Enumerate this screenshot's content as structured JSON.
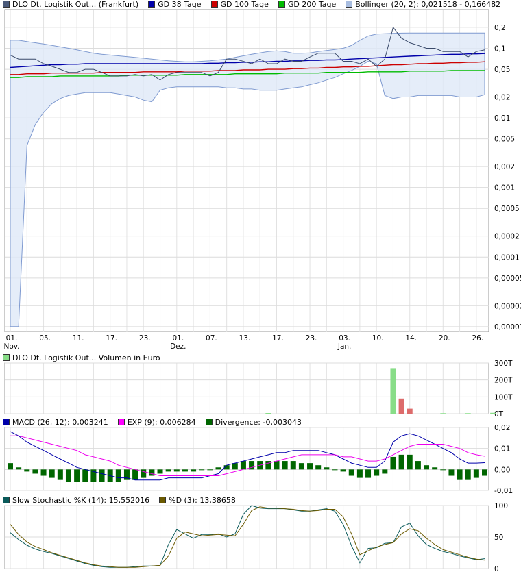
{
  "legends": {
    "price": [
      {
        "label": "DLO Dt. Logistik Out... (Frankfurt)",
        "color": "#4a5a7a"
      },
      {
        "label": "GD 38 Tage",
        "color": "#0000aa"
      },
      {
        "label": "GD 100 Tage",
        "color": "#cc0000"
      },
      {
        "label": "GD 200 Tage",
        "color": "#00bb00"
      },
      {
        "label": "Bollinger (20, 2): 0,021518 - 0,166482",
        "color": "#a8bde0"
      }
    ],
    "volume": [
      {
        "label": "DLO Dt. Logistik Out... Volumen in Euro",
        "color": "#88dd88"
      }
    ],
    "macd": [
      {
        "label": "MACD (26, 12): 0,003241",
        "color": "#0000aa"
      },
      {
        "label": "EXP (9): 0,006284",
        "color": "#ff00ff"
      },
      {
        "label": "Divergence: -0,003043",
        "color": "#006600"
      }
    ],
    "stoch": [
      {
        "label": "Slow Stochastic %K (14): 15,552016",
        "color": "#0a5a5a"
      },
      {
        "label": "%D (3): 13,38658",
        "color": "#6b5a00"
      }
    ]
  },
  "x_axis": {
    "tick_labels": [
      "01.",
      "05.",
      "11.",
      "17.",
      "23.",
      "01.",
      "07.",
      "13.",
      "17.",
      "23.",
      "03.",
      "10.",
      "14.",
      "20.",
      "26."
    ],
    "tick_index": [
      0,
      4,
      8,
      12,
      16,
      20,
      24,
      28,
      32,
      36,
      40,
      44,
      48,
      52,
      56
    ],
    "month_labels": [
      {
        "text": "Nov.",
        "index": 0
      },
      {
        "text": "Dez.",
        "index": 20
      },
      {
        "text": "Jan.",
        "index": 40
      }
    ]
  },
  "chart_data": [
    {
      "type": "line",
      "scale": "log",
      "y_ticks": [
        {
          "label": "0,2",
          "v": 0.2
        },
        {
          "label": "0,1",
          "v": 0.1
        },
        {
          "label": "0,05",
          "v": 0.05
        },
        {
          "label": "0,02",
          "v": 0.02
        },
        {
          "label": "0,01",
          "v": 0.01
        },
        {
          "label": "0,005",
          "v": 0.005
        },
        {
          "label": "0,002",
          "v": 0.002
        },
        {
          "label": "0,001",
          "v": 0.001
        },
        {
          "label": "0,0005",
          "v": 0.0005
        },
        {
          "label": "0,0002",
          "v": 0.0002
        },
        {
          "label": "0,0001",
          "v": 0.0001
        },
        {
          "label": "0,00005",
          "v": 5e-05
        },
        {
          "label": "0,00002",
          "v": 2e-05
        },
        {
          "label": "0,00001",
          "v": 1e-05
        }
      ],
      "ylim": [
        8.5e-06,
        0.36
      ],
      "boll_upper": [
        0.13,
        0.13,
        0.125,
        0.12,
        0.115,
        0.11,
        0.105,
        0.1,
        0.095,
        0.09,
        0.085,
        0.082,
        0.08,
        0.078,
        0.076,
        0.074,
        0.072,
        0.07,
        0.068,
        0.066,
        0.065,
        0.064,
        0.064,
        0.065,
        0.066,
        0.068,
        0.07,
        0.074,
        0.078,
        0.082,
        0.086,
        0.09,
        0.092,
        0.09,
        0.085,
        0.085,
        0.086,
        0.09,
        0.093,
        0.096,
        0.1,
        0.11,
        0.13,
        0.15,
        0.16,
        0.162,
        0.164,
        0.165,
        0.166,
        0.166,
        0.166,
        0.166,
        0.166,
        0.166,
        0.166,
        0.166,
        0.166,
        0.166
      ],
      "boll_lower": [
        1e-05,
        1e-05,
        0.004,
        0.008,
        0.012,
        0.016,
        0.019,
        0.021,
        0.022,
        0.023,
        0.023,
        0.023,
        0.023,
        0.022,
        0.021,
        0.02,
        0.018,
        0.017,
        0.025,
        0.027,
        0.028,
        0.028,
        0.028,
        0.028,
        0.028,
        0.028,
        0.027,
        0.027,
        0.026,
        0.026,
        0.025,
        0.025,
        0.025,
        0.026,
        0.027,
        0.028,
        0.03,
        0.032,
        0.035,
        0.038,
        0.043,
        0.048,
        0.055,
        0.065,
        0.06,
        0.021,
        0.019,
        0.02,
        0.02,
        0.021,
        0.021,
        0.021,
        0.021,
        0.021,
        0.02,
        0.02,
        0.02,
        0.0215
      ],
      "series": [
        {
          "name": "DLO Dt. Logistik Out... (Frankfurt)",
          "color": "#3a4a6a",
          "values": [
            0.08,
            0.07,
            0.07,
            0.07,
            0.06,
            0.055,
            0.05,
            0.045,
            0.045,
            0.05,
            0.05,
            0.045,
            0.04,
            0.04,
            0.04,
            0.042,
            0.04,
            0.042,
            0.035,
            0.042,
            0.045,
            0.045,
            0.045,
            0.045,
            0.04,
            0.045,
            0.07,
            0.07,
            0.065,
            0.06,
            0.07,
            0.06,
            0.06,
            0.07,
            0.065,
            0.065,
            0.075,
            0.085,
            0.085,
            0.085,
            0.065,
            0.065,
            0.06,
            0.07,
            0.055,
            0.07,
            0.2,
            0.14,
            0.12,
            0.11,
            0.1,
            0.1,
            0.09,
            0.09,
            0.09,
            0.075,
            0.09,
            0.095
          ]
        },
        {
          "name": "GD 38 Tage",
          "color": "#0000aa",
          "values": [
            0.053,
            0.054,
            0.055,
            0.056,
            0.057,
            0.058,
            0.058,
            0.059,
            0.059,
            0.06,
            0.06,
            0.06,
            0.06,
            0.06,
            0.06,
            0.06,
            0.06,
            0.06,
            0.06,
            0.06,
            0.06,
            0.06,
            0.06,
            0.06,
            0.061,
            0.061,
            0.062,
            0.062,
            0.063,
            0.063,
            0.064,
            0.064,
            0.065,
            0.065,
            0.066,
            0.066,
            0.067,
            0.067,
            0.068,
            0.068,
            0.069,
            0.07,
            0.071,
            0.072,
            0.073,
            0.074,
            0.075,
            0.076,
            0.077,
            0.078,
            0.079,
            0.08,
            0.081,
            0.082,
            0.082,
            0.083,
            0.083,
            0.084
          ]
        },
        {
          "name": "GD 100 Tage",
          "color": "#cc0000",
          "values": [
            0.042,
            0.042,
            0.043,
            0.043,
            0.043,
            0.044,
            0.044,
            0.044,
            0.044,
            0.044,
            0.044,
            0.045,
            0.045,
            0.045,
            0.045,
            0.045,
            0.046,
            0.046,
            0.046,
            0.046,
            0.046,
            0.047,
            0.047,
            0.047,
            0.047,
            0.048,
            0.048,
            0.048,
            0.049,
            0.049,
            0.049,
            0.05,
            0.05,
            0.05,
            0.051,
            0.051,
            0.052,
            0.052,
            0.053,
            0.053,
            0.054,
            0.054,
            0.055,
            0.055,
            0.056,
            0.057,
            0.058,
            0.058,
            0.059,
            0.06,
            0.06,
            0.061,
            0.061,
            0.062,
            0.062,
            0.063,
            0.063,
            0.064
          ]
        },
        {
          "name": "GD 200 Tage",
          "color": "#00bb00",
          "values": [
            0.038,
            0.038,
            0.039,
            0.039,
            0.039,
            0.039,
            0.04,
            0.04,
            0.04,
            0.04,
            0.04,
            0.04,
            0.04,
            0.04,
            0.041,
            0.041,
            0.041,
            0.041,
            0.041,
            0.041,
            0.041,
            0.042,
            0.042,
            0.042,
            0.042,
            0.042,
            0.042,
            0.043,
            0.043,
            0.043,
            0.043,
            0.043,
            0.043,
            0.044,
            0.044,
            0.044,
            0.044,
            0.044,
            0.045,
            0.045,
            0.045,
            0.045,
            0.045,
            0.046,
            0.046,
            0.046,
            0.046,
            0.046,
            0.047,
            0.047,
            0.047,
            0.047,
            0.047,
            0.048,
            0.048,
            0.048,
            0.048,
            0.048
          ]
        }
      ]
    },
    {
      "type": "bar",
      "y_ticks": [
        {
          "label": "300T",
          "v": 300
        },
        {
          "label": "200T",
          "v": 200
        },
        {
          "label": "100T",
          "v": 100
        },
        {
          "label": "0T",
          "v": 0
        }
      ],
      "ylim": [
        0,
        300
      ],
      "bars": [
        {
          "index": 31,
          "value": 4,
          "color": "#88dd88"
        },
        {
          "index": 46,
          "value": 270,
          "color": "#88dd88"
        },
        {
          "index": 47,
          "value": 90,
          "color": "#dd6b6b"
        },
        {
          "index": 48,
          "value": 30,
          "color": "#dd6b6b"
        },
        {
          "index": 52,
          "value": 3,
          "color": "#88dd88"
        },
        {
          "index": 55,
          "value": 3,
          "color": "#88dd88"
        },
        {
          "index": 58,
          "value": 5,
          "color": "#88dd88"
        }
      ]
    },
    {
      "type": "line",
      "y_ticks": [
        {
          "label": "0,02",
          "v": 0.02
        },
        {
          "label": "0,01",
          "v": 0.01
        },
        {
          "label": "0,00",
          "v": 0
        },
        {
          "label": "-0,01",
          "v": -0.01
        }
      ],
      "ylim": [
        -0.01,
        0.02
      ],
      "series": [
        {
          "name": "MACD (26, 12)",
          "color": "#0000aa",
          "values": [
            0.018,
            0.016,
            0.013,
            0.011,
            0.009,
            0.007,
            0.005,
            0.003,
            0.001,
            0,
            -0.001,
            -0.002,
            -0.003,
            -0.004,
            -0.004,
            -0.005,
            -0.005,
            -0.005,
            -0.005,
            -0.004,
            -0.004,
            -0.004,
            -0.004,
            -0.004,
            -0.003,
            -0.002,
            0.002,
            0.003,
            0.004,
            0.005,
            0.006,
            0.007,
            0.008,
            0.008,
            0.009,
            0.009,
            0.009,
            0.009,
            0.008,
            0.007,
            0.005,
            0.003,
            0.002,
            0.001,
            0.001,
            0.004,
            0.013,
            0.016,
            0.017,
            0.016,
            0.014,
            0.012,
            0.01,
            0.008,
            0.005,
            0.003,
            0.003,
            0.0032
          ]
        },
        {
          "name": "EXP (9)",
          "color": "#ee00ee",
          "values": [
            0.016,
            0.016,
            0.015,
            0.014,
            0.013,
            0.012,
            0.011,
            0.01,
            0.009,
            0.007,
            0.006,
            0.005,
            0.004,
            0.002,
            0.001,
            0,
            -0.001,
            -0.002,
            -0.003,
            -0.003,
            -0.003,
            -0.003,
            -0.003,
            -0.003,
            -0.003,
            -0.003,
            -0.002,
            -0.001,
            0,
            0.001,
            0.002,
            0.003,
            0.004,
            0.005,
            0.006,
            0.007,
            0.007,
            0.007,
            0.007,
            0.007,
            0.006,
            0.006,
            0.005,
            0.004,
            0.004,
            0.005,
            0.007,
            0.009,
            0.011,
            0.012,
            0.012,
            0.012,
            0.012,
            0.011,
            0.01,
            0.008,
            0.007,
            0.0063
          ]
        }
      ],
      "divergence": {
        "color": "#006600",
        "values": [
          0.003,
          0.001,
          -0.001,
          -0.002,
          -0.003,
          -0.004,
          -0.005,
          -0.006,
          -0.006,
          -0.006,
          -0.006,
          -0.006,
          -0.006,
          -0.006,
          -0.005,
          -0.005,
          -0.004,
          -0.003,
          -0.002,
          -0.001,
          -0.001,
          -0.001,
          -0.001,
          0,
          0,
          0.001,
          0.002,
          0.003,
          0.004,
          0.004,
          0.004,
          0.004,
          0.004,
          0.004,
          0.004,
          0.003,
          0.003,
          0.002,
          0.001,
          0,
          -0.001,
          -0.003,
          -0.004,
          -0.004,
          -0.003,
          -0.002,
          0.006,
          0.007,
          0.007,
          0.004,
          0.002,
          0.001,
          0,
          -0.003,
          -0.005,
          -0.005,
          -0.004,
          -0.003
        ]
      }
    },
    {
      "type": "line",
      "y_ticks": [
        {
          "label": "100",
          "v": 100
        },
        {
          "label": "50",
          "v": 50
        },
        {
          "label": "0",
          "v": 0
        }
      ],
      "ylim": [
        0,
        100
      ],
      "series": [
        {
          "name": "Slow Stochastic %K (14)",
          "color": "#0a5a5a",
          "values": [
            57,
            46,
            37,
            31,
            27,
            24,
            20,
            16,
            12,
            8,
            5,
            3,
            2,
            2,
            2,
            3,
            4,
            4,
            5,
            38,
            62,
            55,
            48,
            54,
            54,
            55,
            50,
            55,
            86,
            100,
            96,
            95,
            95,
            95,
            93,
            91,
            91,
            93,
            95,
            91,
            70,
            36,
            9,
            32,
            33,
            40,
            41,
            66,
            72,
            52,
            38,
            32,
            27,
            24,
            20,
            17,
            14,
            15.6
          ]
        },
        {
          "name": "%D (3)",
          "color": "#6b5a00",
          "values": [
            70,
            54,
            42,
            35,
            30,
            25,
            21,
            17,
            13,
            9,
            6,
            4,
            3,
            2,
            2,
            2,
            3,
            4,
            5,
            20,
            48,
            58,
            55,
            52,
            53,
            54,
            53,
            52,
            70,
            92,
            98,
            96,
            96,
            95,
            94,
            92,
            91,
            92,
            94,
            94,
            82,
            55,
            22,
            28,
            34,
            38,
            41,
            55,
            63,
            60,
            48,
            38,
            30,
            26,
            22,
            18,
            15,
            13.4
          ]
        }
      ]
    }
  ]
}
